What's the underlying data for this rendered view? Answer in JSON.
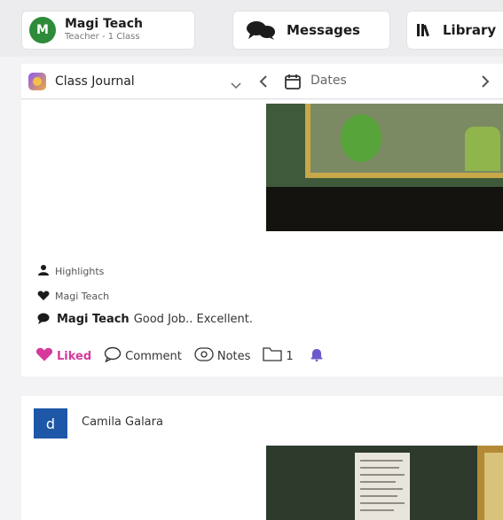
{
  "topbar": {
    "user": {
      "initial": "M",
      "name": "Magi Teach",
      "subtitle": "Teacher - 1 Class"
    },
    "messages_label": "Messages",
    "library_label": "Library"
  },
  "filters": {
    "journal_label": "Class Journal",
    "dates_label": "Dates"
  },
  "post1": {
    "highlights_label": "Highlights",
    "liked_by": "Magi Teach",
    "comment_author": "Magi Teach",
    "comment_text": "Good Job.. Excellent.",
    "actions": {
      "liked_label": "Liked",
      "comment_label": "Comment",
      "notes_label": "Notes",
      "folder_count": "1"
    }
  },
  "post2": {
    "author_initial": "d",
    "author_name": "Camila Galara"
  },
  "colors": {
    "accent_pink": "#d6399c",
    "avatar_green": "#2e8b3a",
    "author_blue": "#1f57a8",
    "bell_purple": "#6a5acd"
  },
  "icons": [
    "chat-bubbles-icon",
    "library-books-icon",
    "chevron-down-icon",
    "chevron-left-icon",
    "calendar-icon",
    "chevron-right-icon",
    "highlights-icon",
    "heart-icon",
    "speech-bubble-icon",
    "comment-icon",
    "notes-icon",
    "folder-icon",
    "bell-icon"
  ]
}
